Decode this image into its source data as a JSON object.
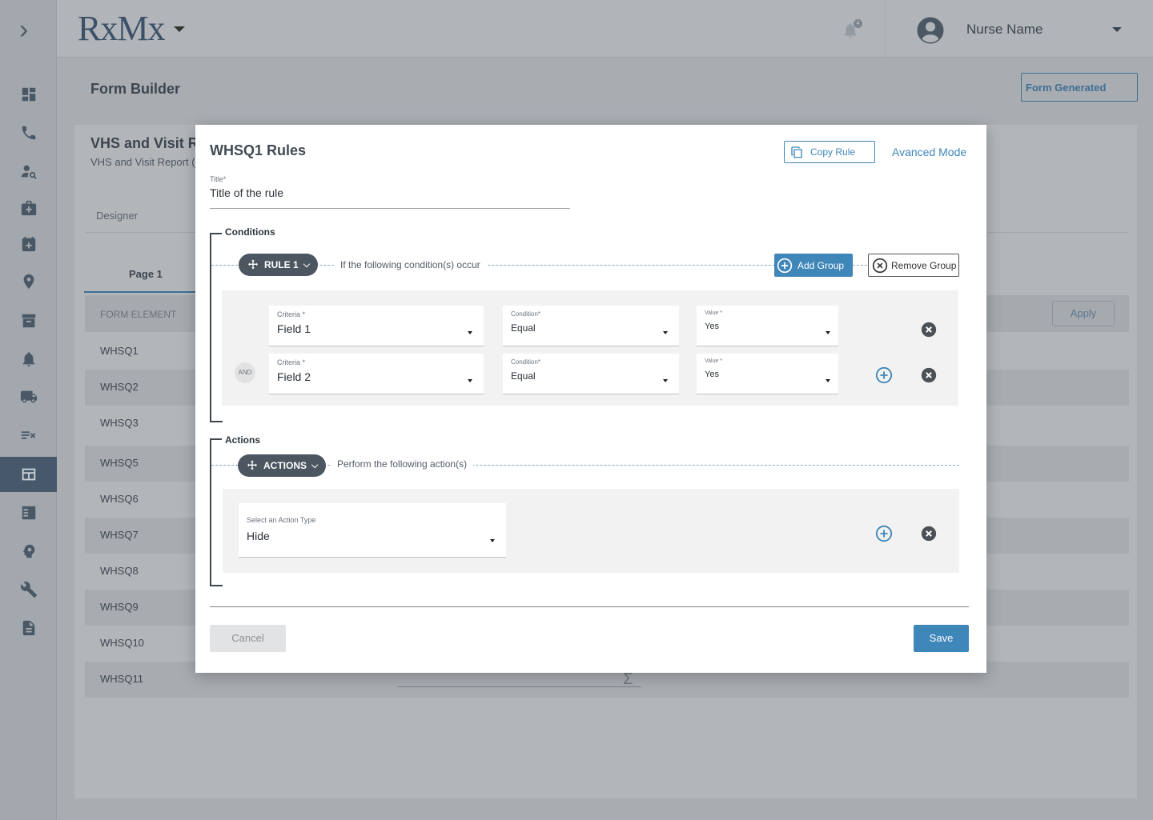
{
  "app": {
    "logo_text": "RxMx",
    "logo_tagline": "",
    "notification_count": "4",
    "user_name": "Nurse Name"
  },
  "sidebar": {
    "items": [
      {
        "icon": "dashboard-icon"
      },
      {
        "icon": "phone-icon"
      },
      {
        "icon": "person-search-icon"
      },
      {
        "icon": "medical-kit-icon"
      },
      {
        "icon": "medical-calendar-icon"
      },
      {
        "icon": "location-pin-icon"
      },
      {
        "icon": "archive-icon"
      },
      {
        "icon": "bell-icon"
      },
      {
        "icon": "truck-icon"
      },
      {
        "icon": "checklist-icon"
      },
      {
        "icon": "form-builder-icon",
        "active": true
      },
      {
        "icon": "task-list-icon"
      },
      {
        "icon": "brain-icon"
      },
      {
        "icon": "wrench-icon"
      },
      {
        "icon": "document-icon"
      }
    ]
  },
  "page": {
    "title": "Form Builder",
    "form_generated_label": "Form Generated",
    "form_title": "VHS and Visit Re",
    "form_subtitle": "VHS and Visit Report (I",
    "tab_designer": "Designer",
    "tab_page1": "Page 1",
    "column_header": "FORM ELEMENT",
    "apply_label": "Apply",
    "rows": [
      "WHSQ1",
      "WHSQ2",
      "WHSQ3",
      "WHSQ5",
      "WHSQ6",
      "WHSQ7",
      "WHSQ8",
      "WHSQ9",
      "WHSQ10",
      "WHSQ11"
    ],
    "sigma_symbol": "Σ"
  },
  "modal": {
    "title": "WHSQ1 Rules",
    "copy_rule_label": "Copy Rule",
    "advanced_mode_label": "Avanced Mode",
    "title_field_label": "Title*",
    "title_field_value": "Title of the rule",
    "conditions": {
      "section_label": "Conditions",
      "rule_pill": "RULE 1",
      "line_text": "If the following condition(s) occur",
      "add_group_label": "Add Group",
      "remove_group_label": "Remove Group",
      "and_label": "AND",
      "rows": [
        {
          "criteria_label": "Criteria *",
          "criteria_value": "Field 1",
          "condition_label": "Condition*",
          "condition_value": "Equal",
          "value_label": "Value *",
          "value_value": "Yes"
        },
        {
          "criteria_label": "Criteria *",
          "criteria_value": "Field 2",
          "condition_label": "Condition*",
          "condition_value": "Equal",
          "value_label": "Value *",
          "value_value": "Yes"
        }
      ]
    },
    "actions": {
      "section_label": "Actions",
      "actions_pill": "ACTIONS",
      "line_text": "Perform the following action(s)",
      "action_type_label": "Select an Action Type",
      "action_type_value": "Hide"
    },
    "cancel_label": "Cancel",
    "save_label": "Save"
  },
  "colors": {
    "accent": "#3f86b9",
    "overlay_bg": "#a9adb2",
    "sidebar_active": "#465869",
    "pill_dark": "#4c5660"
  }
}
